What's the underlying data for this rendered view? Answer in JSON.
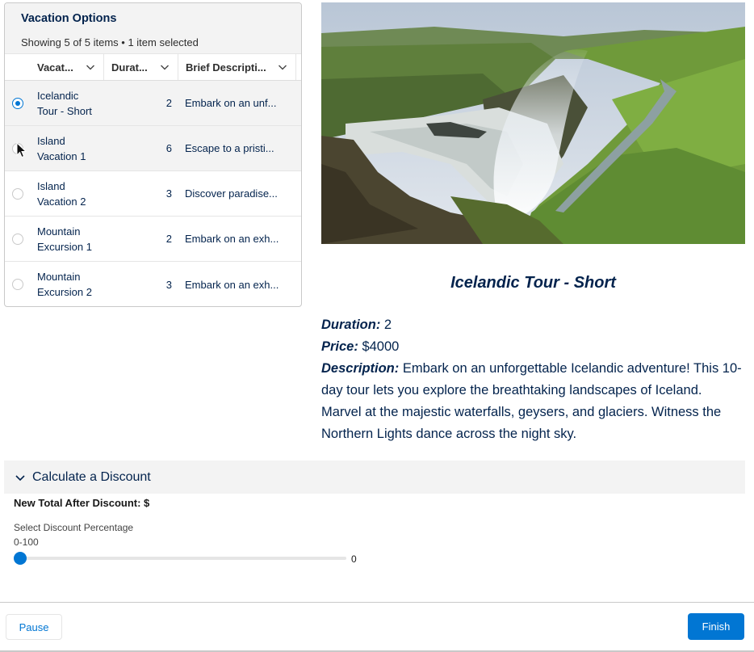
{
  "table": {
    "title": "Vacation Options",
    "subtitle": "Showing 5 of 5 items • 1 item selected",
    "columns": [
      "Vacat...",
      "Durat...",
      "Brief Descripti..."
    ],
    "rows": [
      {
        "name_line1": "Icelandic",
        "name_line2": "Tour - Short",
        "duration": "2",
        "description": "Embark on an unf...",
        "selected": true
      },
      {
        "name_line1": "Island",
        "name_line2": "Vacation 1",
        "duration": "6",
        "description": "Escape to a pristi...",
        "selected": false
      },
      {
        "name_line1": "Island",
        "name_line2": "Vacation 2",
        "duration": "3",
        "description": "Discover paradise...",
        "selected": false
      },
      {
        "name_line1": "Mountain",
        "name_line2": "Excursion 1",
        "duration": "2",
        "description": "Embark on an exh...",
        "selected": false
      },
      {
        "name_line1": "Mountain",
        "name_line2": "Excursion 2",
        "duration": "3",
        "description": "Embark on an exh...",
        "selected": false
      }
    ]
  },
  "detail": {
    "title": "Icelandic Tour - Short",
    "duration_label": "Duration:",
    "duration_value": "2",
    "price_label": "Price:",
    "price_value": "$4000",
    "description_label": "Description:",
    "description_text": "Embark on an unforgettable Icelandic adventure! This 10-day tour lets you explore the breathtaking landscapes of Iceland. Marvel at the majestic waterfalls, geysers, and glaciers. Witness the Northern Lights dance across the night sky."
  },
  "discount": {
    "section_title": "Calculate a Discount",
    "total_label": "New Total After Discount: $",
    "slider_label": "Select Discount Percentage",
    "slider_range": "0-100",
    "slider_value": "0"
  },
  "footer": {
    "pause_label": "Pause",
    "finish_label": "Finish"
  },
  "colors": {
    "brand": "#0176d3",
    "heading": "#03234d",
    "header_bg": "#f3f3f3"
  }
}
